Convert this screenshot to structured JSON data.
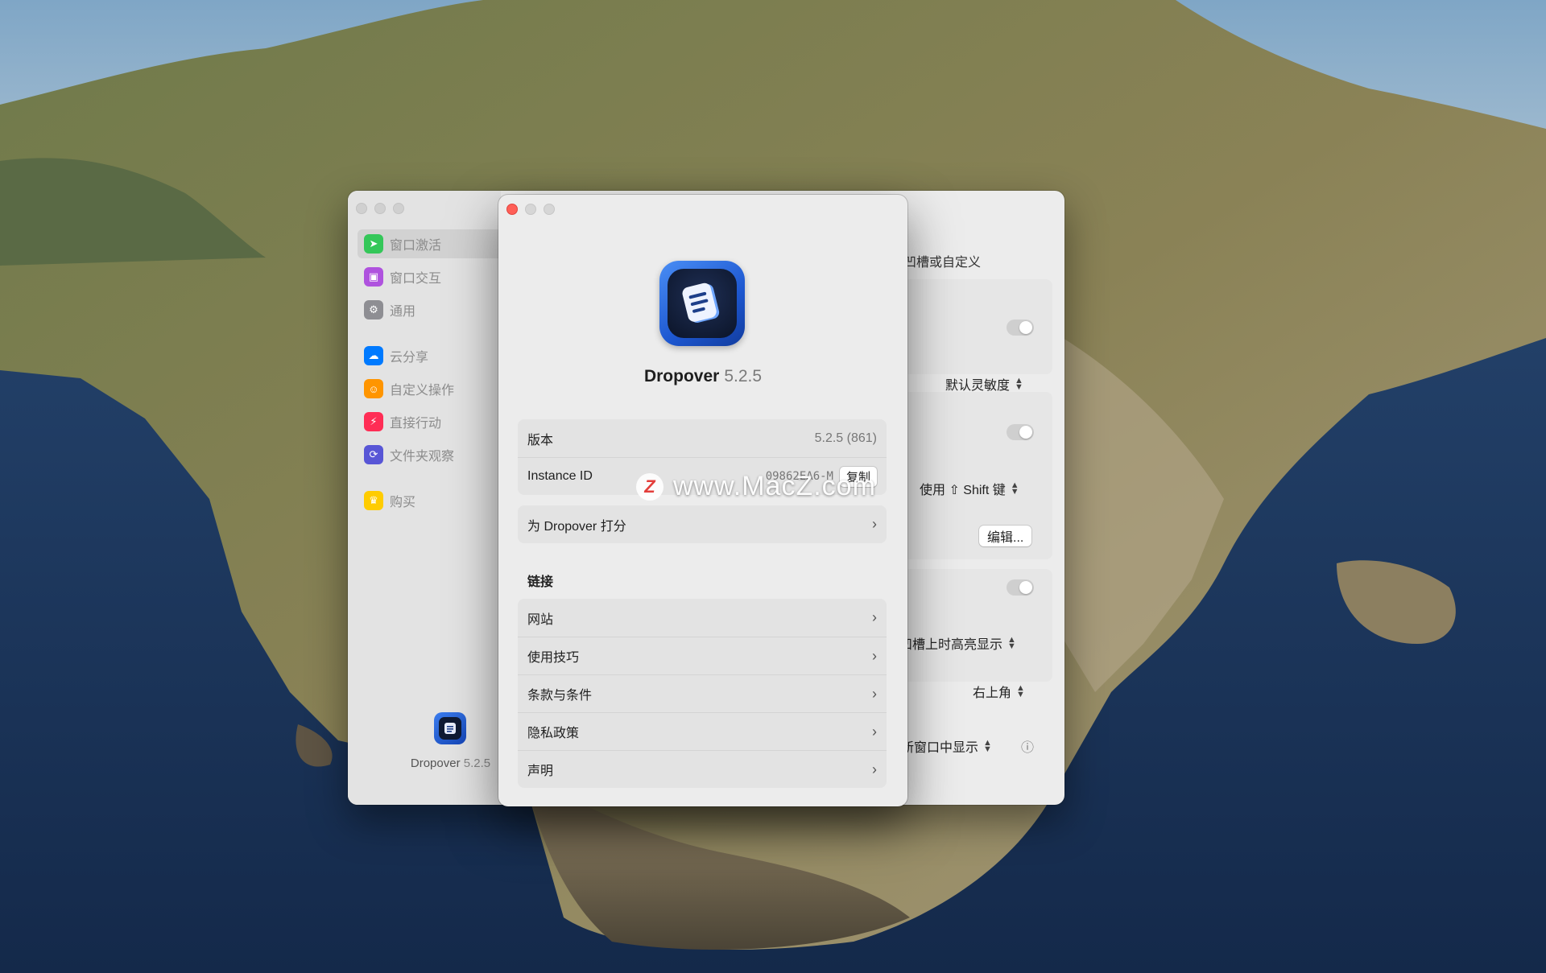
{
  "settings_window": {
    "sidebar": {
      "items": [
        {
          "label": "窗口激活",
          "icon": "cursor-icon",
          "color": "#34c759"
        },
        {
          "label": "窗口交互",
          "icon": "window-icon",
          "color": "#af52de"
        },
        {
          "label": "通用",
          "icon": "gear-icon",
          "color": "#8e8e93"
        },
        {
          "label": "云分享",
          "icon": "cloud-icon",
          "color": "#007aff"
        },
        {
          "label": "自定义操作",
          "icon": "person-icon",
          "color": "#ff9500"
        },
        {
          "label": "直接行动",
          "icon": "bolt-icon",
          "color": "#ff2d55"
        },
        {
          "label": "文件夹观察",
          "icon": "sync-icon",
          "color": "#5856d6"
        },
        {
          "label": "购买",
          "icon": "crown-icon",
          "color": "#ffcc00"
        }
      ],
      "footer_app": "Dropover",
      "footer_version": "5.2.5"
    },
    "content": {
      "partial_text_1": "凹槽或自定义",
      "sensitivity_popup": "默认灵敏度",
      "shift_popup": "使用 ⇧ Shift 键",
      "edit_button": "编辑...",
      "highlight_popup": "凹槽上时高亮显示",
      "position_popup": "右上角",
      "new_window_popup": "新窗口中显示",
      "info_icon": "ⓘ"
    }
  },
  "about_window": {
    "app_name": "Dropover",
    "app_version": "5.2.5",
    "info": {
      "version_label": "版本",
      "version_value": "5.2.5 (861)",
      "instance_label": "Instance ID",
      "instance_value": "09862EA6-M",
      "copy_button": "复制"
    },
    "rate_label": "为 Dropover 打分",
    "links_header": "链接",
    "links": [
      {
        "label": "网站"
      },
      {
        "label": "使用技巧"
      },
      {
        "label": "条款与条件"
      },
      {
        "label": "隐私政策"
      },
      {
        "label": "声明"
      }
    ]
  },
  "watermark": {
    "logo_letter": "Z",
    "text": "www.MacZ.com"
  }
}
